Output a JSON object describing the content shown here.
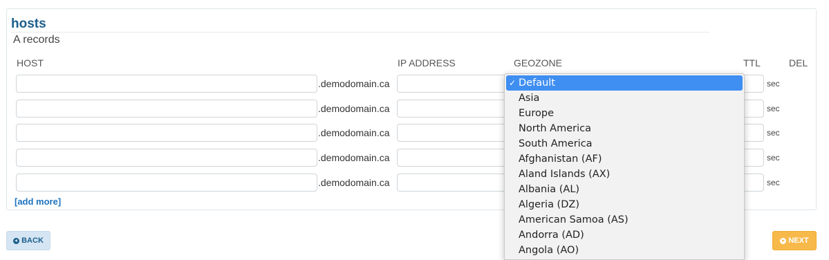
{
  "section": {
    "title": "hosts",
    "subtitle": "A records"
  },
  "columns": {
    "host": "HOST",
    "ip": "IP ADDRESS",
    "geozone": "GEOZONE",
    "ttl": "TTL",
    "del": "DEL"
  },
  "rows": [
    {
      "host": "",
      "suffix": ".demodomain.ca",
      "ip": "",
      "ttl": "",
      "ttl_unit": "sec"
    },
    {
      "host": "",
      "suffix": ".demodomain.ca",
      "ip": "",
      "ttl": "",
      "ttl_unit": "sec"
    },
    {
      "host": "",
      "suffix": ".demodomain.ca",
      "ip": "",
      "ttl": "",
      "ttl_unit": "sec"
    },
    {
      "host": "",
      "suffix": ".demodomain.ca",
      "ip": "",
      "ttl": "",
      "ttl_unit": "sec"
    },
    {
      "host": "",
      "suffix": ".demodomain.ca",
      "ip": "",
      "ttl": "",
      "ttl_unit": "sec"
    }
  ],
  "add_more": "[add more]",
  "geozone_dropdown": {
    "selected": "Default",
    "check_mark": "✓",
    "options": [
      "Default",
      "Asia",
      "Europe",
      "North America",
      "South America",
      "Afghanistan (AF)",
      "Aland Islands (AX)",
      "Albania (AL)",
      "Algeria (DZ)",
      "American Samoa (AS)",
      "Andorra (AD)",
      "Angola (AO)"
    ]
  },
  "buttons": {
    "back": "BACK",
    "next": "NEXT"
  },
  "colors": {
    "title": "#1d5f8c",
    "link": "#1d73be",
    "selected_option": "#3f8ef2",
    "next_button": "#f7b94a",
    "back_button": "#d5e5f3"
  }
}
